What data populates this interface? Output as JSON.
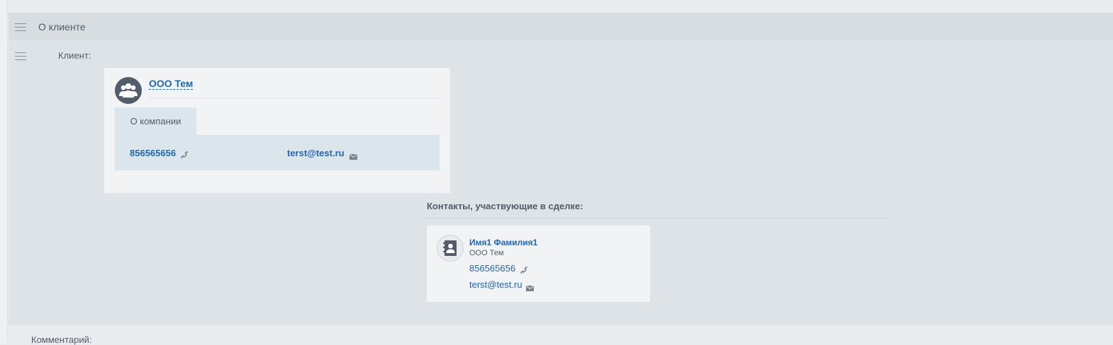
{
  "section": {
    "title": "О клиенте",
    "client_label": "Клиент:",
    "comment_label": "Комментарий:"
  },
  "company_card": {
    "name": "ООО Тем",
    "avatar_icon": "users-group-icon",
    "tab_label": "О компании",
    "phone": "856565656",
    "email": "terst@test.ru"
  },
  "contacts": {
    "title": "Контакты, участвующие в сделке:",
    "items": [
      {
        "name": "Имя1 Фамилия1",
        "company": "ООО Тем",
        "phone": "856565656",
        "email": "terst@test.ru",
        "avatar_icon": "contact-book-icon"
      }
    ]
  },
  "colors": {
    "link": "#2067b0",
    "text": "#535c69",
    "section_bg": "#dde3e6",
    "panel_bg": "#dbe6ec"
  }
}
